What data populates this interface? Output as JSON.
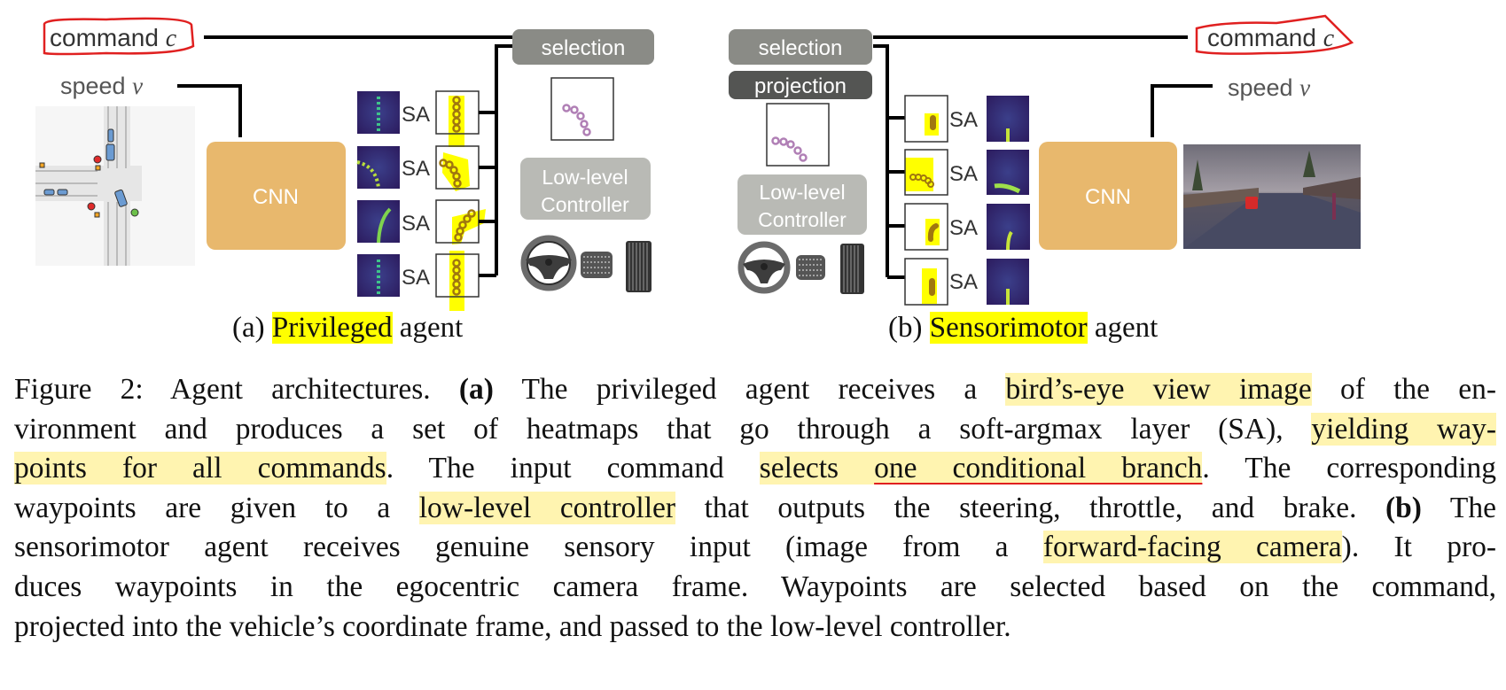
{
  "colors": {
    "cnn": "#e8b86d",
    "selection": "#8a8b86",
    "projection": "#545553",
    "controller": "#b9bab5",
    "waypoint": "#b07fb5",
    "highlight_bright": "#ffff00",
    "highlight_caption": "#fff4b0",
    "annotation_red": "#e02020"
  },
  "panel_a": {
    "command_label": "command",
    "command_var": "c",
    "speed_label": "speed",
    "speed_var": "v",
    "cnn_label": "CNN",
    "sa_label": "SA",
    "selection_label": "selection",
    "controller_line1": "Low-level",
    "controller_line2": "Controller",
    "subcaption_prefix": "(a) ",
    "subcaption_highlight": "Privileged",
    "subcaption_suffix": " agent"
  },
  "panel_b": {
    "command_label": "command",
    "command_var": "c",
    "speed_label": "speed",
    "speed_var": "v",
    "cnn_label": "CNN",
    "sa_label": "SA",
    "selection_label": "selection",
    "projection_label": "projection",
    "controller_line1": "Low-level",
    "controller_line2": "Controller",
    "subcaption_prefix": "(b) ",
    "subcaption_highlight": "Sensorimotor",
    "subcaption_suffix": " agent"
  },
  "caption": {
    "lines": [
      [
        {
          "t": "Figure 2: Agent architectures. "
        },
        {
          "t": "(a)",
          "s": "b"
        },
        {
          "t": " The privileged agent receives a "
        },
        {
          "t": "bird’s-eye view image",
          "s": "hl"
        },
        {
          "t": " of the en-"
        }
      ],
      [
        {
          "t": "vironment and produces a set of heatmaps that go through a soft-argmax layer (SA), "
        },
        {
          "t": "yielding way-",
          "s": "hl"
        }
      ],
      [
        {
          "t": "points for all commands",
          "s": "hl"
        },
        {
          "t": ".  The input command "
        },
        {
          "t": "selects ",
          "s": "hl"
        },
        {
          "t": "one conditional branch",
          "s": "hl ul"
        },
        {
          "t": ".  The corresponding"
        }
      ],
      [
        {
          "t": "waypoints are given to a "
        },
        {
          "t": "low-level controller",
          "s": "hl"
        },
        {
          "t": " that outputs the steering, throttle, and brake. "
        },
        {
          "t": "(b)",
          "s": "b"
        },
        {
          "t": " The"
        }
      ],
      [
        {
          "t": "sensorimotor agent receives genuine sensory input (image from a "
        },
        {
          "t": "forward-facing camera",
          "s": "hl"
        },
        {
          "t": ").  It pro-"
        }
      ],
      [
        {
          "t": "duces waypoints in the egocentric camera frame.  Waypoints are selected based on the command,"
        }
      ],
      [
        {
          "t": "projected into the vehicle’s coordinate frame, and passed to the low-level controller."
        }
      ]
    ]
  }
}
